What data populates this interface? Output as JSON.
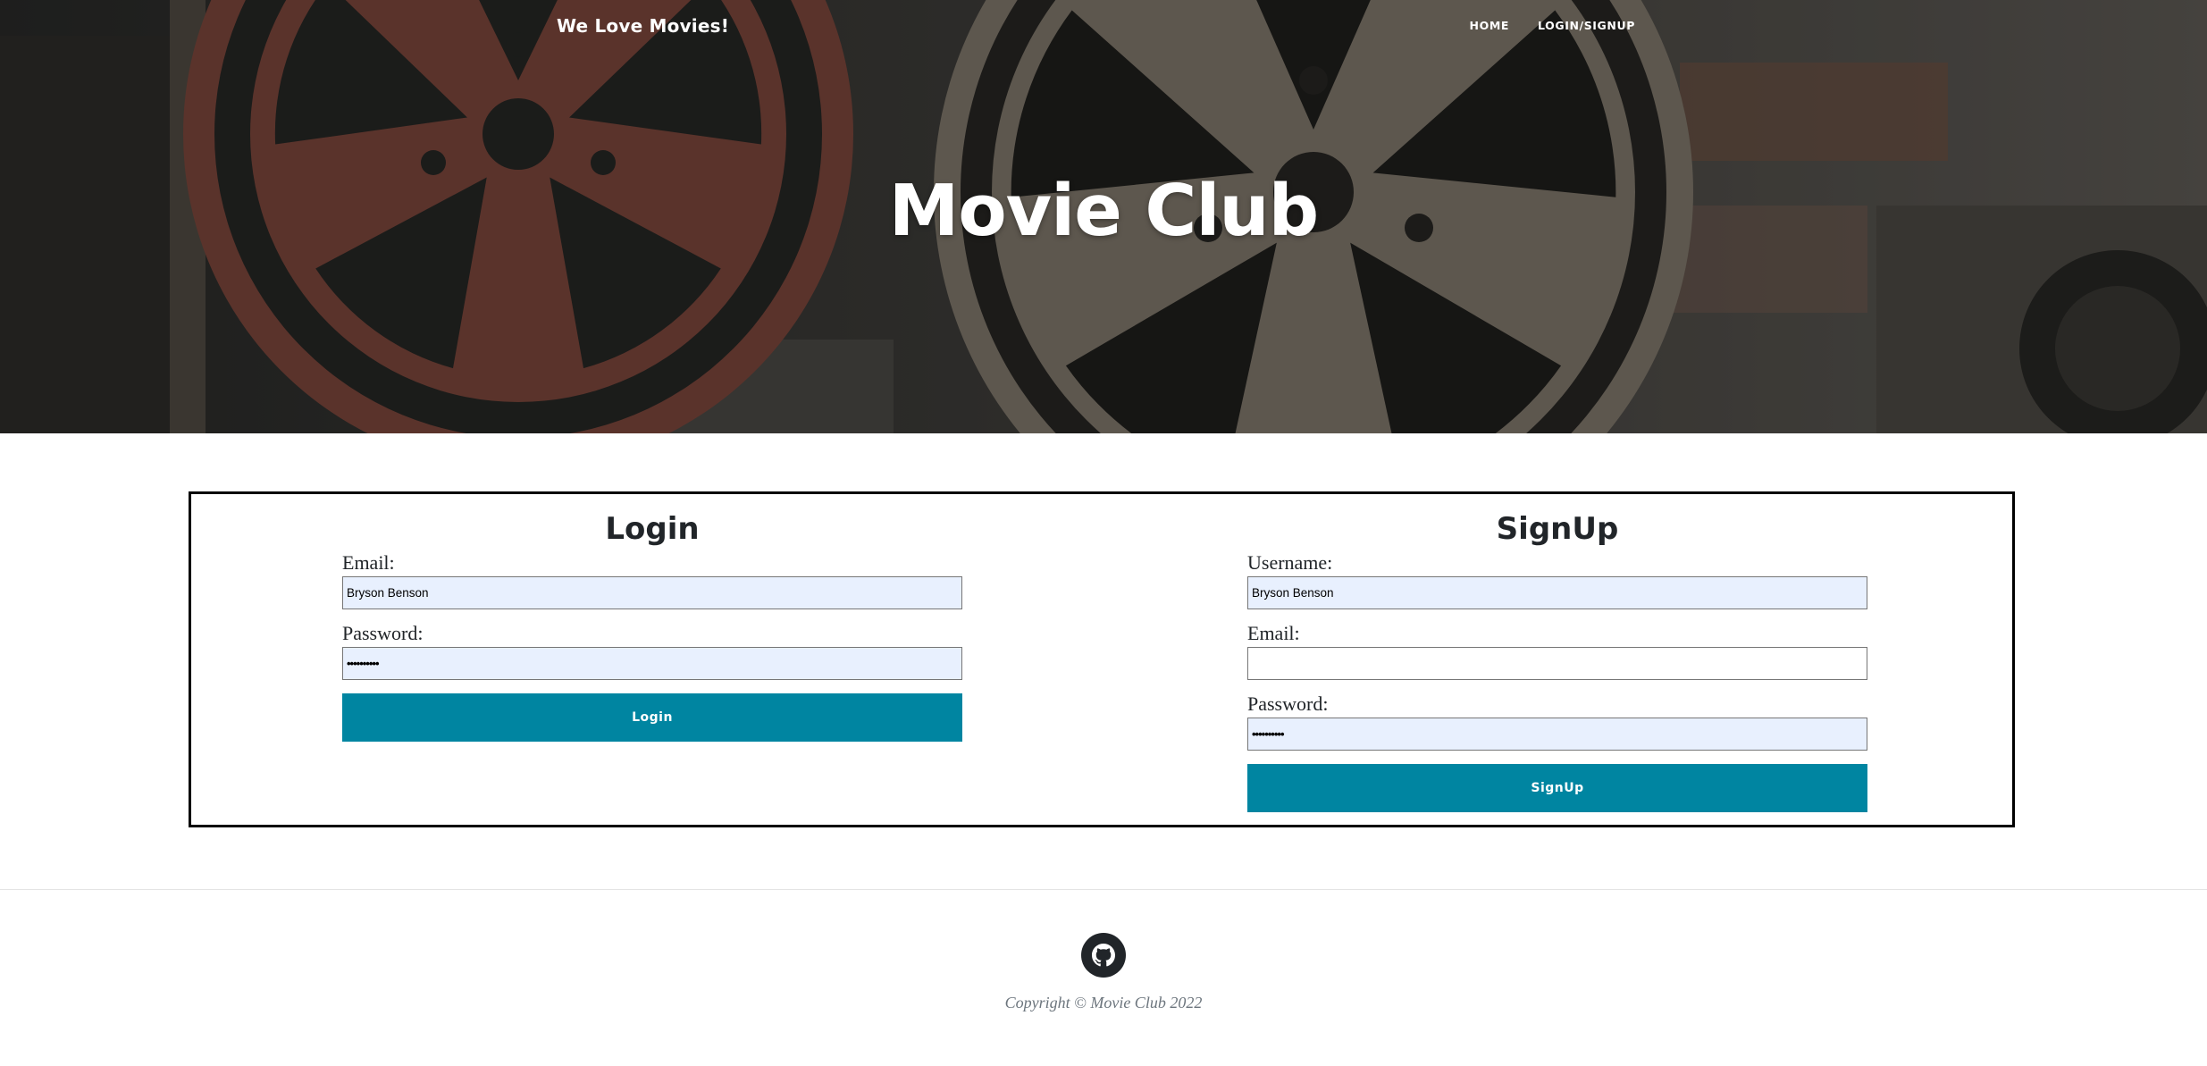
{
  "header": {
    "brand": "We Love Movies!",
    "nav": [
      {
        "label": "HOME"
      },
      {
        "label": "LOGIN/SIGNUP"
      }
    ]
  },
  "hero": {
    "title": "Movie Club"
  },
  "login": {
    "title": "Login",
    "email_label": "Email:",
    "email_value": "Bryson Benson",
    "password_label": "Password:",
    "password_value": "••••••••••",
    "button": "Login"
  },
  "signup": {
    "title": "SignUp",
    "username_label": "Username:",
    "username_value": "Bryson Benson",
    "email_label": "Email:",
    "email_value": "",
    "password_label": "Password:",
    "password_value": "••••••••••",
    "button": "SignUp"
  },
  "footer": {
    "icon": "github-icon",
    "copyright": "Copyright © Movie Club 2022"
  },
  "colors": {
    "accent": "#0085a1",
    "autofill": "#e8f0fe",
    "text": "#212529",
    "muted": "#6c757d"
  }
}
